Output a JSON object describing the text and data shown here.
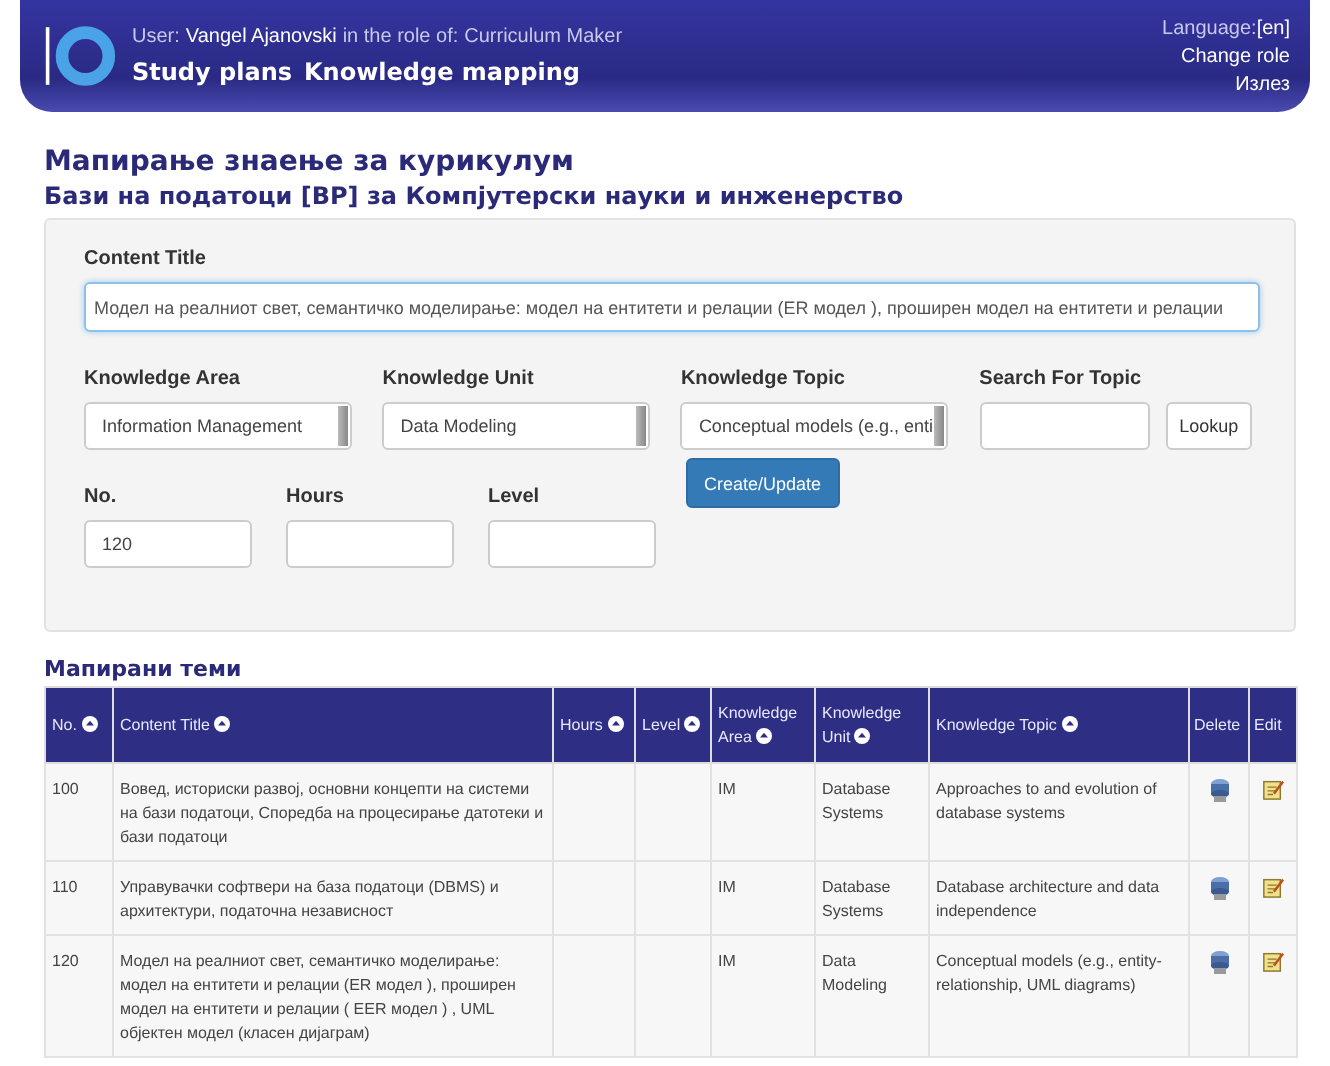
{
  "header": {
    "user_label": "User:",
    "user_name": "Vangel Ajanovski",
    "role_label": "in the role of:",
    "role": "Curriculum Maker",
    "nav": [
      "Study plans",
      "Knowledge mapping"
    ],
    "language_label": "Language:",
    "language": "[en]",
    "links": [
      "Change role",
      "Излез"
    ]
  },
  "page_title": "Мапирање знаење за курикулум",
  "subtitle": "Бази на податоци [BP] за Компјутерски науки и инженерство",
  "form": {
    "content_title": {
      "label": "Content Title",
      "value": "Модел на реалниот свет, семантичко моделирање: модел на ентитети и релации (ER модел ), проширен модел на ентитети и релации"
    },
    "selects": [
      {
        "label": "Knowledge Area",
        "value": "Information Management"
      },
      {
        "label": "Knowledge Unit",
        "value": "Data Modeling"
      },
      {
        "label": "Knowledge Topic",
        "value": "Conceptual models (e.g., enti"
      }
    ],
    "search": {
      "label": "Search For Topic"
    },
    "lookup_button": "Lookup",
    "fields": [
      {
        "label": "No.",
        "value": "120"
      },
      {
        "label": "Hours"
      },
      {
        "label": "Level"
      }
    ],
    "submit_button": "Create/Update"
  },
  "table": {
    "title": "Мапирани теми",
    "columns": [
      {
        "label": "No.",
        "sortable": true
      },
      {
        "label": "Content Title",
        "sortable": true
      },
      {
        "label": "Hours",
        "sortable": true
      },
      {
        "label": "Level",
        "sortable": true
      },
      {
        "label": "Knowledge Area",
        "sortable": true
      },
      {
        "label": "Knowledge Unit",
        "sortable": true
      },
      {
        "label": "Knowledge Topic",
        "sortable": true
      },
      {
        "label": "Delete",
        "sortable": false
      },
      {
        "label": "Edit",
        "sortable": false
      }
    ],
    "rows": [
      {
        "no": "100",
        "title": "Вовед, историски развој, основни концепти на системи на бази податоци, Споредба на процесирање датотеки и бази податоци",
        "area": "IM",
        "unit": "Database Systems",
        "topic": "Approaches to and evolution of database systems"
      },
      {
        "no": "110",
        "title": "Управувачки софтвери на база податоци (DBMS) и архитектури, податочна независност",
        "area": "IM",
        "unit": "Database Systems",
        "topic": "Database architecture and data independence"
      },
      {
        "no": "120",
        "title": "Модел на реалниот свет, семантичко моделирање: модел на ентитети и релации (ER модел ), проширен модел на ентитети и релации ( EER модел ) , UML објектен модел (класен дијаграм)",
        "area": "IM",
        "unit": "Data Modeling",
        "topic": "Conceptual models (e.g., entity-relationship, UML diagrams)"
      }
    ]
  }
}
